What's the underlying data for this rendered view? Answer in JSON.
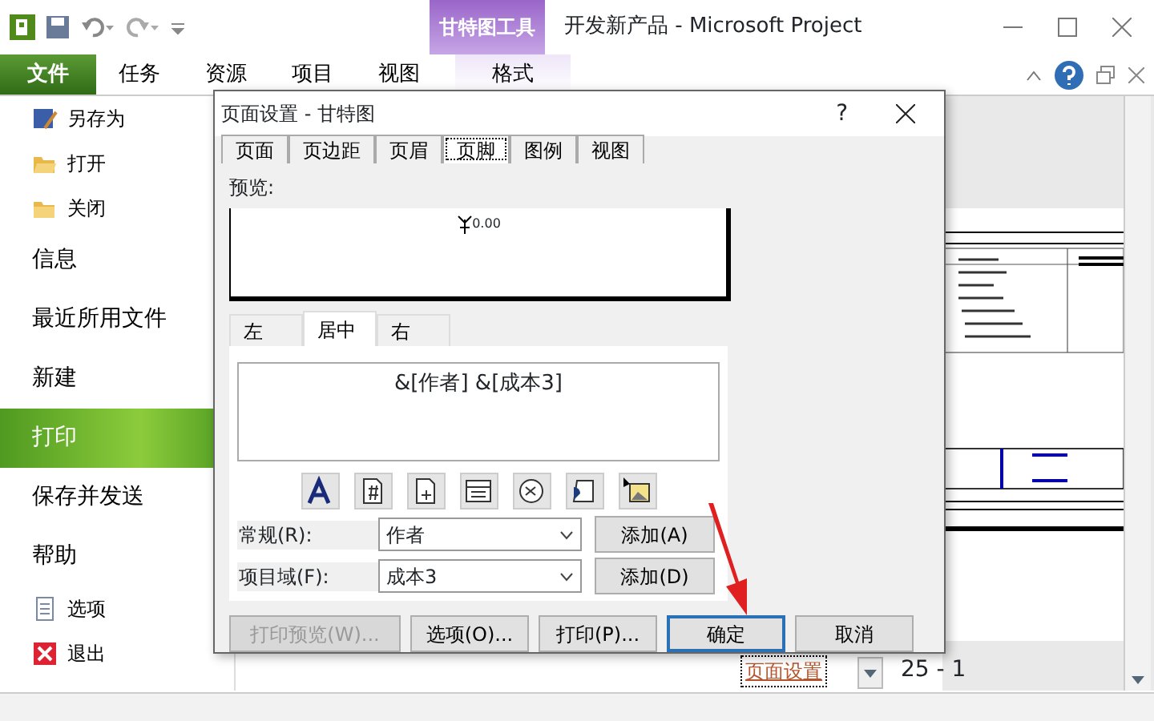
{
  "window": {
    "title": "开发新产品  -  Microsoft Project",
    "context_group": "甘特图工具"
  },
  "ribbon_tabs": [
    {
      "label": "文件",
      "kind": "file",
      "selected": true
    },
    {
      "label": "任务",
      "kind": "tab",
      "selected": false
    },
    {
      "label": "资源",
      "kind": "tab",
      "selected": false
    },
    {
      "label": "项目",
      "kind": "tab",
      "selected": false
    },
    {
      "label": "视图",
      "kind": "tab",
      "selected": false
    },
    {
      "label": "格式",
      "kind": "context",
      "selected": false
    }
  ],
  "backstage": [
    {
      "label": "另存为",
      "kind": "command",
      "selected": false
    },
    {
      "label": "打开",
      "kind": "command",
      "selected": false
    },
    {
      "label": "关闭",
      "kind": "command",
      "selected": false
    },
    {
      "label": "信息",
      "kind": "page",
      "selected": false
    },
    {
      "label": "最近所用文件",
      "kind": "page",
      "selected": false
    },
    {
      "label": "新建",
      "kind": "page",
      "selected": false
    },
    {
      "label": "打印",
      "kind": "page",
      "selected": true
    },
    {
      "label": "保存并发送",
      "kind": "page",
      "selected": false
    },
    {
      "label": "帮助",
      "kind": "page",
      "selected": false
    },
    {
      "label": "选项",
      "kind": "command",
      "selected": false
    },
    {
      "label": "退出",
      "kind": "command",
      "selected": false
    }
  ],
  "dialog": {
    "title": "页面设置 - 甘特图",
    "help": "?",
    "tabs": [
      {
        "label": "页面",
        "selected": false
      },
      {
        "label": "页边距",
        "selected": false
      },
      {
        "label": "页眉",
        "selected": false
      },
      {
        "label": "页脚",
        "selected": true
      },
      {
        "label": "图例",
        "selected": false
      },
      {
        "label": "视图",
        "selected": false
      }
    ],
    "preview_label": "预览:",
    "preview_value": "0.00",
    "align_tabs": [
      {
        "label": "左",
        "selected": false
      },
      {
        "label": "居中",
        "selected": true
      },
      {
        "label": "右",
        "selected": false
      }
    ],
    "footer_text": "&[作者] &[成本3]",
    "fields": [
      {
        "label": "常规(R):",
        "value": "作者",
        "button": "添加(A)"
      },
      {
        "label": "项目域(F):",
        "value": "成本3",
        "button": "添加(D)"
      }
    ],
    "buttons": [
      {
        "label": "打印预览(W)...",
        "disabled": true,
        "default": false
      },
      {
        "label": "选项(O)...",
        "disabled": false,
        "default": false
      },
      {
        "label": "打印(P)...",
        "disabled": false,
        "default": false
      },
      {
        "label": "确定",
        "disabled": false,
        "default": true
      },
      {
        "label": "取消",
        "disabled": false,
        "default": false
      }
    ]
  },
  "print_panel": {
    "page_setup_link": "页面设置",
    "page_indicator": "25 - 1"
  }
}
